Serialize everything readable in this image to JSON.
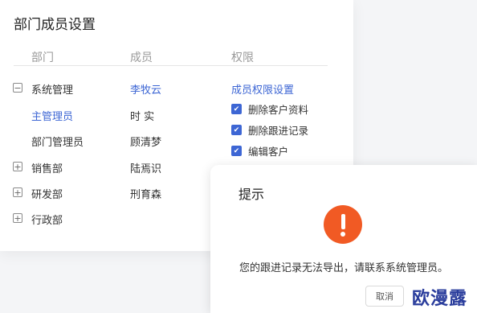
{
  "card": {
    "title": "部门成员设置",
    "columns": {
      "dept": "部门",
      "member": "成员",
      "perm": "权限"
    }
  },
  "departments": [
    {
      "label": "系统管理",
      "expander": "minus"
    },
    {
      "label": "主管理员",
      "active": true
    },
    {
      "label": "部门管理员"
    },
    {
      "label": "销售部",
      "expander": "plus"
    },
    {
      "label": "研发部",
      "expander": "plus"
    },
    {
      "label": "行政部",
      "expander": "plus"
    }
  ],
  "members": [
    "李牧云",
    "时 实",
    "顾清梦",
    "陆焉识",
    "刑育森"
  ],
  "permissions": {
    "title": "成员权限设置",
    "items": [
      {
        "label": "删除客户资料",
        "checked": true
      },
      {
        "label": "删除跟进记录",
        "checked": true
      },
      {
        "label": "编辑客户",
        "checked": true
      }
    ]
  },
  "dialog": {
    "title": "提示",
    "message": "您的跟进记录无法导出，请联系系统管理员。",
    "cancel_label": "取消"
  },
  "watermark": "欧漫露",
  "colors": {
    "accent": "#3d66d4",
    "warning": "#f15a24"
  }
}
